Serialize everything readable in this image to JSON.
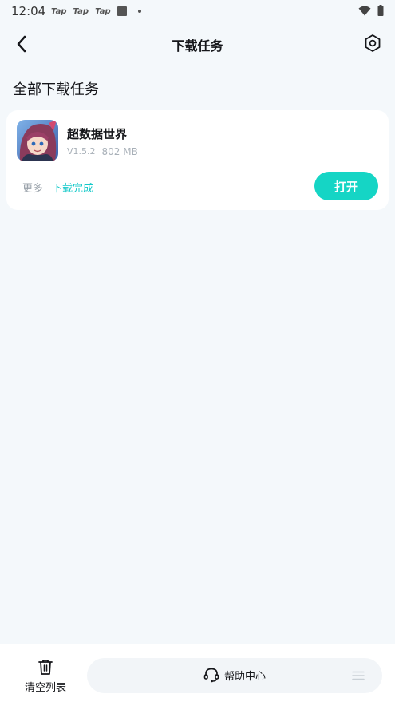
{
  "status_bar": {
    "time": "12:04",
    "notifications": [
      "Tap",
      "Tap",
      "Tap"
    ]
  },
  "header": {
    "title": "下载任务"
  },
  "section": {
    "title": "全部下载任务"
  },
  "tasks": [
    {
      "app_name": "超数据世界",
      "version": "V1.5.2",
      "size": "802 MB",
      "more_label": "更多",
      "status": "下载完成",
      "action_label": "打开"
    }
  ],
  "bottom_bar": {
    "clear_label": "清空列表",
    "help_label": "帮助中心"
  },
  "colors": {
    "accent": "#15d5c5",
    "status_text": "#14c9c9",
    "background": "#f4f8fb"
  },
  "icons": [
    "back-arrow-icon",
    "settings-hex-icon",
    "trash-icon",
    "headset-icon",
    "menu-lines-icon",
    "wifi-icon",
    "battery-icon"
  ]
}
